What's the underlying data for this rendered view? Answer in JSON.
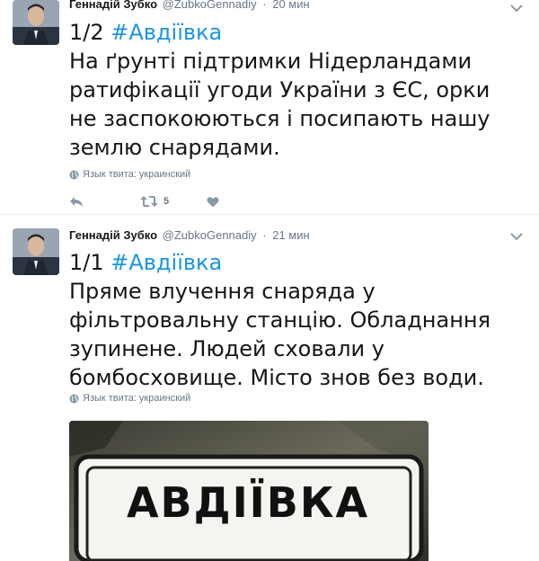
{
  "tweets": [
    {
      "fullname": "Геннадій Зубко",
      "username": "@ZubkoGennadiy",
      "time": "20 мин",
      "text_prefix": "1/2 ",
      "hashtag": "#Авдіївка",
      "text_body": "На ґрунті підтримки Нідерландами ратифікації угоди України з ЄС, орки не заспокоюються і посипають нашу землю снарядами.",
      "language": "Язык твита: украинский",
      "retweet_count": "5"
    },
    {
      "fullname": "Геннадій Зубко",
      "username": "@ZubkoGennadiy",
      "time": "21 мин",
      "text_prefix": "1/1 ",
      "hashtag": "#Авдіївка",
      "text_body": "Пряме влучення снаряда у фільтровальну станцію. Обладнання зупинене. Людей сховали у бомбосховище. Місто знов без води.",
      "language": "Язык твита: украинский",
      "media_sign_text": "АВДІЇВКА"
    }
  ],
  "colors": {
    "link": "#1b95e0",
    "secondary_text": "#657786",
    "primary_text": "#14171a",
    "divider": "#e6ecf0"
  },
  "icons": [
    "caret-down-icon",
    "globe-icon",
    "reply-icon",
    "retweet-icon",
    "heart-icon"
  ]
}
